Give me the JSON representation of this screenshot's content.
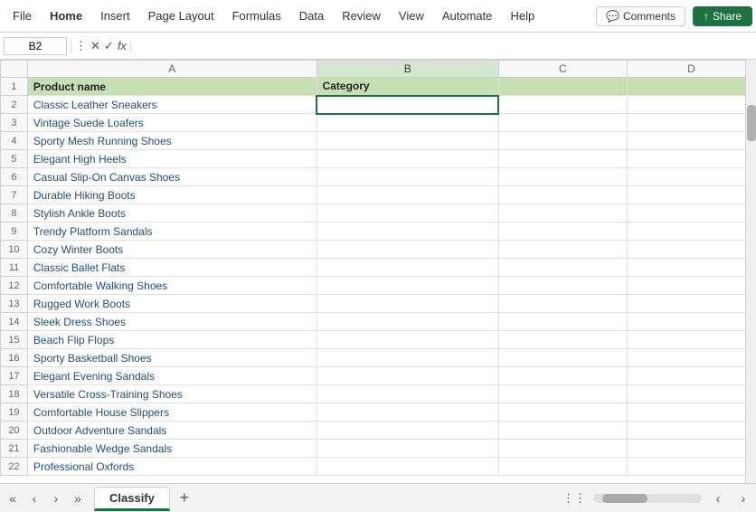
{
  "menubar": {
    "items": [
      "File",
      "Home",
      "Insert",
      "Page Layout",
      "Formulas",
      "Data",
      "Review",
      "View",
      "Automate",
      "Help"
    ],
    "comments_label": "Comments",
    "share_label": "Share"
  },
  "formulabar": {
    "cell_ref": "B2",
    "formula": ""
  },
  "spreadsheet": {
    "col_headers": [
      "",
      "A",
      "B",
      "C",
      "D"
    ],
    "header_row": {
      "row_num": "1",
      "col_a": "Product name",
      "col_b": "Category",
      "col_c": "",
      "col_d": ""
    },
    "rows": [
      {
        "num": "2",
        "a": "Classic Leather Sneakers",
        "b_selected": true,
        "b": ""
      },
      {
        "num": "3",
        "a": "Vintage Suede Loafers",
        "b": ""
      },
      {
        "num": "4",
        "a": "Sporty Mesh Running Shoes",
        "b": ""
      },
      {
        "num": "5",
        "a": "Elegant High Heels",
        "b": ""
      },
      {
        "num": "6",
        "a": "Casual Slip-On Canvas Shoes",
        "b": ""
      },
      {
        "num": "7",
        "a": "Durable Hiking Boots",
        "b": ""
      },
      {
        "num": "8",
        "a": "Stylish Ankle Boots",
        "b": ""
      },
      {
        "num": "9",
        "a": "Trendy Platform Sandals",
        "b": ""
      },
      {
        "num": "10",
        "a": "Cozy Winter Boots",
        "b": ""
      },
      {
        "num": "11",
        "a": "Classic Ballet Flats",
        "b": ""
      },
      {
        "num": "12",
        "a": "Comfortable Walking Shoes",
        "b": ""
      },
      {
        "num": "13",
        "a": "Rugged Work Boots",
        "b": ""
      },
      {
        "num": "14",
        "a": "Sleek Dress Shoes",
        "b": ""
      },
      {
        "num": "15",
        "a": "Beach Flip Flops",
        "b": ""
      },
      {
        "num": "16",
        "a": "Sporty Basketball Shoes",
        "b": ""
      },
      {
        "num": "17",
        "a": "Elegant Evening Sandals",
        "b": ""
      },
      {
        "num": "18",
        "a": "Versatile Cross-Training Shoes",
        "b": ""
      },
      {
        "num": "19",
        "a": "Comfortable House Slippers",
        "b": ""
      },
      {
        "num": "20",
        "a": "Outdoor Adventure Sandals",
        "b": ""
      },
      {
        "num": "21",
        "a": "Fashionable Wedge Sandals",
        "b": ""
      },
      {
        "num": "22",
        "a": "Professional Oxfords",
        "b": ""
      }
    ]
  },
  "sheet_tabs": {
    "active_tab": "Classify",
    "add_sheet_label": "+"
  },
  "icons": {
    "chevron_left": "‹",
    "chevron_right": "›",
    "double_left": "«",
    "double_right": "»",
    "comment_icon": "💬",
    "share_icon": "↑",
    "cancel_icon": "✕",
    "check_icon": "✓",
    "fx_icon": "fx",
    "more_icon": "⋮"
  }
}
